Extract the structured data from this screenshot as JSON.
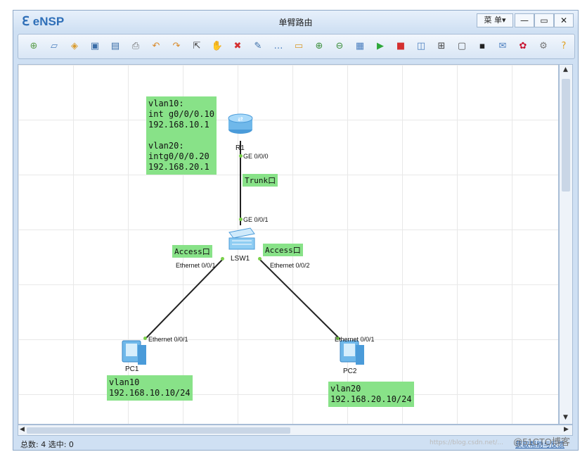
{
  "window": {
    "app_name": "eNSP",
    "title": "单臂路由",
    "menu_label": "菜 单▾",
    "minimize": "—",
    "maximize": "▭",
    "close": "✕"
  },
  "toolbar": {
    "icons": [
      "new-topology-icon",
      "new-template-icon",
      "open-icon",
      "save-icon",
      "save-as-icon",
      "print-icon",
      "undo-icon",
      "redo-icon",
      "select-icon",
      "pan-icon",
      "delete-icon",
      "delete-link-icon",
      "text-icon",
      "palette-icon",
      "zoom-in-icon",
      "zoom-out-icon",
      "fit-icon",
      "start-icon",
      "stop-icon",
      "capture-icon",
      "topology-icon",
      "panel-icon",
      "terminal-icon",
      "chat-icon",
      "huawei-icon",
      "settings-icon",
      "help-icon"
    ],
    "glyphs": [
      "⊕",
      "▱",
      "◈",
      "▣",
      "▤",
      "⎙",
      "↶",
      "↷",
      "⇱",
      "✋",
      "✖",
      "✎",
      "…",
      "▭",
      "⊕",
      "⊖",
      "▦",
      "▶",
      "■",
      "◫",
      "⊞",
      "▢",
      "▪",
      "✉",
      "✿",
      "⚙",
      "?"
    ],
    "colors": [
      "#5a9d4a",
      "#4c7fbf",
      "#d99a2b",
      "#3b6ea8",
      "#3b6ea8",
      "#6b6b6b",
      "#d98a2b",
      "#d98a2b",
      "#444444",
      "#d98a2b",
      "#d43030",
      "#3b6ea8",
      "#4c7fbf",
      "#d99a2b",
      "#3c8f3c",
      "#3c8f3c",
      "#4c7fbf",
      "#2fa83a",
      "#d43030",
      "#4c7fbf",
      "#444444",
      "#555555",
      "#222222",
      "#4c7fbf",
      "#c8102e",
      "#777777",
      "#e0a020"
    ]
  },
  "topology": {
    "note_r1": "vlan10:\nint g0/0/0.10\n192.168.10.1\n\nvlan20:\nintg0/0/0.20\n192.168.20.1",
    "router_name": "R1",
    "r1_port": "GE 0/0/0",
    "trunk_tag": "Trunk口",
    "switch_port_top": "GE 0/0/1",
    "switch_name": "LSW1",
    "access_left": "Access口",
    "access_right": "Access口",
    "sw_port_left": "Ethernet 0/0/1",
    "sw_port_right": "Ethernet 0/0/2",
    "pc1_port": "Ethernet 0/0/1",
    "pc2_port": "Ethernet 0/0/1",
    "pc1_name": "PC1",
    "pc2_name": "PC2",
    "pc1_note": "vlan10\n192.168.10.10/24",
    "pc2_note": "vlan20\n192.168.20.10/24"
  },
  "status": {
    "summary": "总数: 4 选中: 0",
    "right_link": "获取帮助与反馈",
    "watermark": "https://blog.csdn.net/...",
    "brand": "@51CTO博客"
  }
}
